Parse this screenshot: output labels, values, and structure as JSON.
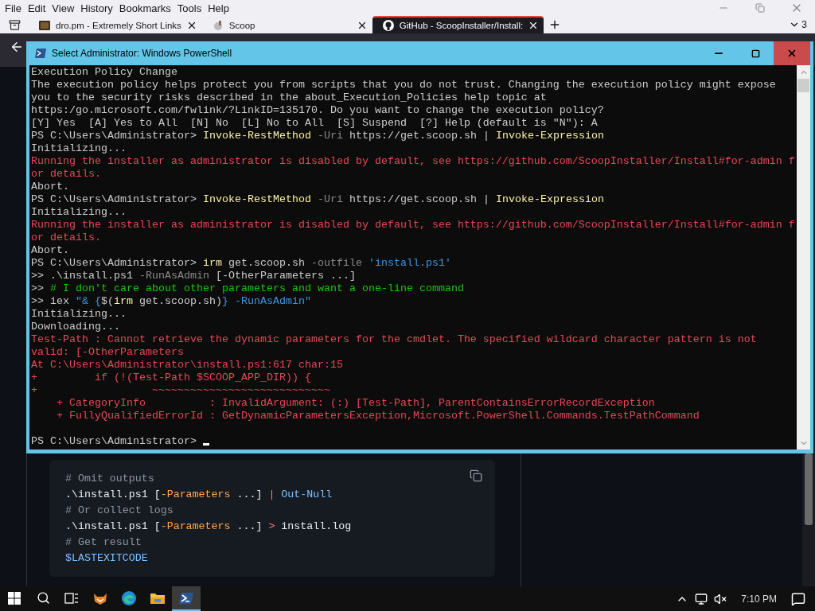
{
  "browser": {
    "menu": [
      "File",
      "Edit",
      "View",
      "History",
      "Bookmarks",
      "Tools",
      "Help"
    ],
    "tabs": [
      {
        "title": "dro.pm - Extremely Short Links",
        "kind": "square",
        "selected": false
      },
      {
        "title": "Scoop",
        "kind": "scoop",
        "selected": false
      },
      {
        "title": "GitHub - ScoopInstaller/Install:",
        "kind": "github",
        "selected": true
      }
    ],
    "tab_count": "3"
  },
  "page": {
    "code_block": {
      "lines": [
        {
          "segments": [
            {
              "text": "# Omit outputs",
              "kind": "comment"
            }
          ]
        },
        {
          "segments": [
            {
              "text": ".\\install.ps1 [",
              "kind": "plain"
            },
            {
              "text": "-Parameters",
              "kind": "param"
            },
            {
              "text": " ...] ",
              "kind": "plain"
            },
            {
              "text": "|",
              "kind": "op"
            },
            {
              "text": " Out-Null",
              "kind": "builtin"
            }
          ]
        },
        {
          "segments": [
            {
              "text": "# Or collect logs",
              "kind": "comment"
            }
          ]
        },
        {
          "segments": [
            {
              "text": ".\\install.ps1 [",
              "kind": "plain"
            },
            {
              "text": "-Parameters",
              "kind": "param"
            },
            {
              "text": " ...] ",
              "kind": "plain"
            },
            {
              "text": ">",
              "kind": "op"
            },
            {
              "text": " install.log",
              "kind": "plain"
            }
          ]
        },
        {
          "segments": [
            {
              "text": "# Get result",
              "kind": "comment"
            }
          ]
        },
        {
          "segments": [
            {
              "text": "$LASTEXITCODE",
              "kind": "builtin"
            }
          ]
        }
      ]
    }
  },
  "powershell": {
    "title": "Select Administrator: Windows PowerShell",
    "lines": [
      {
        "kind": "text",
        "segments": [
          {
            "text": "Execution Policy Change",
            "kind": "plain"
          }
        ]
      },
      {
        "kind": "text",
        "segments": [
          {
            "text": "The execution policy helps protect you from scripts that you do not trust. Changing the execution policy might expose",
            "kind": "plain"
          }
        ]
      },
      {
        "kind": "text",
        "segments": [
          {
            "text": "you to the security risks described in the about_Execution_Policies help topic at",
            "kind": "plain"
          }
        ]
      },
      {
        "kind": "text",
        "segments": [
          {
            "text": "https:/go.microsoft.com/fwlink/?LinkID=135170. Do you want to change the execution policy?",
            "kind": "plain"
          }
        ]
      },
      {
        "kind": "text",
        "segments": [
          {
            "text": "[Y] Yes  [A] Yes to All  [N] No  [L] No to All  [S] Suspend  [?] Help (default is \"N\"): A",
            "kind": "plain"
          }
        ]
      },
      {
        "kind": "text",
        "segments": [
          {
            "text": "PS C:\\Users\\Administrator> ",
            "kind": "plain"
          },
          {
            "text": "Invoke-RestMethod",
            "kind": "command"
          },
          {
            "text": " -Uri",
            "kind": "param"
          },
          {
            "text": " https://get.scoop.sh | ",
            "kind": "plain"
          },
          {
            "text": "Invoke-Expression",
            "kind": "command"
          }
        ]
      },
      {
        "kind": "text",
        "segments": [
          {
            "text": "Initializing...",
            "kind": "plain"
          }
        ]
      },
      {
        "kind": "text",
        "segments": [
          {
            "text": "Running the installer as administrator is disabled by default, see https://github.com/ScoopInstaller/Install#for-admin f",
            "kind": "error"
          }
        ]
      },
      {
        "kind": "text",
        "segments": [
          {
            "text": "or details.",
            "kind": "error"
          }
        ]
      },
      {
        "kind": "text",
        "segments": [
          {
            "text": "Abort.",
            "kind": "plain"
          }
        ]
      },
      {
        "kind": "text",
        "segments": [
          {
            "text": "PS C:\\Users\\Administrator> ",
            "kind": "plain"
          },
          {
            "text": "Invoke-RestMethod",
            "kind": "command"
          },
          {
            "text": " -Uri",
            "kind": "param"
          },
          {
            "text": " https://get.scoop.sh | ",
            "kind": "plain"
          },
          {
            "text": "Invoke-Expression",
            "kind": "command"
          }
        ]
      },
      {
        "kind": "text",
        "segments": [
          {
            "text": "Initializing...",
            "kind": "plain"
          }
        ]
      },
      {
        "kind": "text",
        "segments": [
          {
            "text": "Running the installer as administrator is disabled by default, see https://github.com/ScoopInstaller/Install#for-admin f",
            "kind": "error"
          }
        ]
      },
      {
        "kind": "text",
        "segments": [
          {
            "text": "or details.",
            "kind": "error"
          }
        ]
      },
      {
        "kind": "text",
        "segments": [
          {
            "text": "Abort.",
            "kind": "plain"
          }
        ]
      },
      {
        "kind": "text",
        "segments": [
          {
            "text": "PS C:\\Users\\Administrator> ",
            "kind": "plain"
          },
          {
            "text": "irm",
            "kind": "command"
          },
          {
            "text": " get.scoop.sh ",
            "kind": "plain"
          },
          {
            "text": "-outfile",
            "kind": "param"
          },
          {
            "text": " 'install.ps1'",
            "kind": "string"
          }
        ]
      },
      {
        "kind": "text",
        "segments": [
          {
            "text": ">> .\\install.ps1 ",
            "kind": "plain"
          },
          {
            "text": "-RunAsAdmin",
            "kind": "param"
          },
          {
            "text": " [-OtherParameters ...]",
            "kind": "plain"
          }
        ]
      },
      {
        "kind": "text",
        "segments": [
          {
            "text": ">> ",
            "kind": "plain"
          },
          {
            "text": "# I don't care about other parameters and want a one-line command",
            "kind": "comment"
          }
        ]
      },
      {
        "kind": "text",
        "segments": [
          {
            "text": ">> iex ",
            "kind": "plain"
          },
          {
            "text": "\"& {",
            "kind": "string"
          },
          {
            "text": "$(",
            "kind": "plain"
          },
          {
            "text": "irm",
            "kind": "command"
          },
          {
            "text": " get.scoop.sh)",
            "kind": "plain"
          },
          {
            "text": "} -RunAsAdmin\"",
            "kind": "string"
          }
        ]
      },
      {
        "kind": "text",
        "segments": [
          {
            "text": "Initializing...",
            "kind": "plain"
          }
        ]
      },
      {
        "kind": "text",
        "segments": [
          {
            "text": "Downloading...",
            "kind": "plain"
          }
        ]
      },
      {
        "kind": "text",
        "segments": [
          {
            "text": "Test-Path : Cannot retrieve the dynamic parameters for the cmdlet. The specified wildcard character pattern is not",
            "kind": "error"
          }
        ]
      },
      {
        "kind": "text",
        "segments": [
          {
            "text": "valid: [-OtherParameters",
            "kind": "error"
          }
        ]
      },
      {
        "kind": "text",
        "segments": [
          {
            "text": "At C:\\Users\\Administrator\\install.ps1:617 char:15",
            "kind": "error"
          }
        ]
      },
      {
        "kind": "text",
        "segments": [
          {
            "text": "+         if (!(Test-Path $SCOOP_APP_DIR)) {",
            "kind": "error"
          }
        ]
      },
      {
        "kind": "text",
        "segments": [
          {
            "text": "+                  ~~~~~~~~~~~~~~~~~~~~~~~~~~~~",
            "kind": "error"
          }
        ]
      },
      {
        "kind": "text",
        "segments": [
          {
            "text": "    + CategoryInfo          : InvalidArgument: (:) [Test-Path], ParentContainsErrorRecordException",
            "kind": "error"
          }
        ]
      },
      {
        "kind": "text",
        "segments": [
          {
            "text": "    + FullyQualifiedErrorId : GetDynamicParametersException,Microsoft.PowerShell.Commands.TestPathCommand",
            "kind": "error"
          }
        ]
      },
      {
        "kind": "blank"
      },
      {
        "kind": "text",
        "cursor": true,
        "segments": [
          {
            "text": "PS C:\\Users\\Administrator> ",
            "kind": "plain"
          }
        ]
      }
    ]
  },
  "taskbar": {
    "apps": [
      {
        "kind": "fox",
        "selected": false
      },
      {
        "kind": "edge",
        "selected": false
      },
      {
        "kind": "folder",
        "selected": false
      },
      {
        "kind": "powershell",
        "selected": true
      }
    ],
    "clock": "7:10 PM"
  }
}
